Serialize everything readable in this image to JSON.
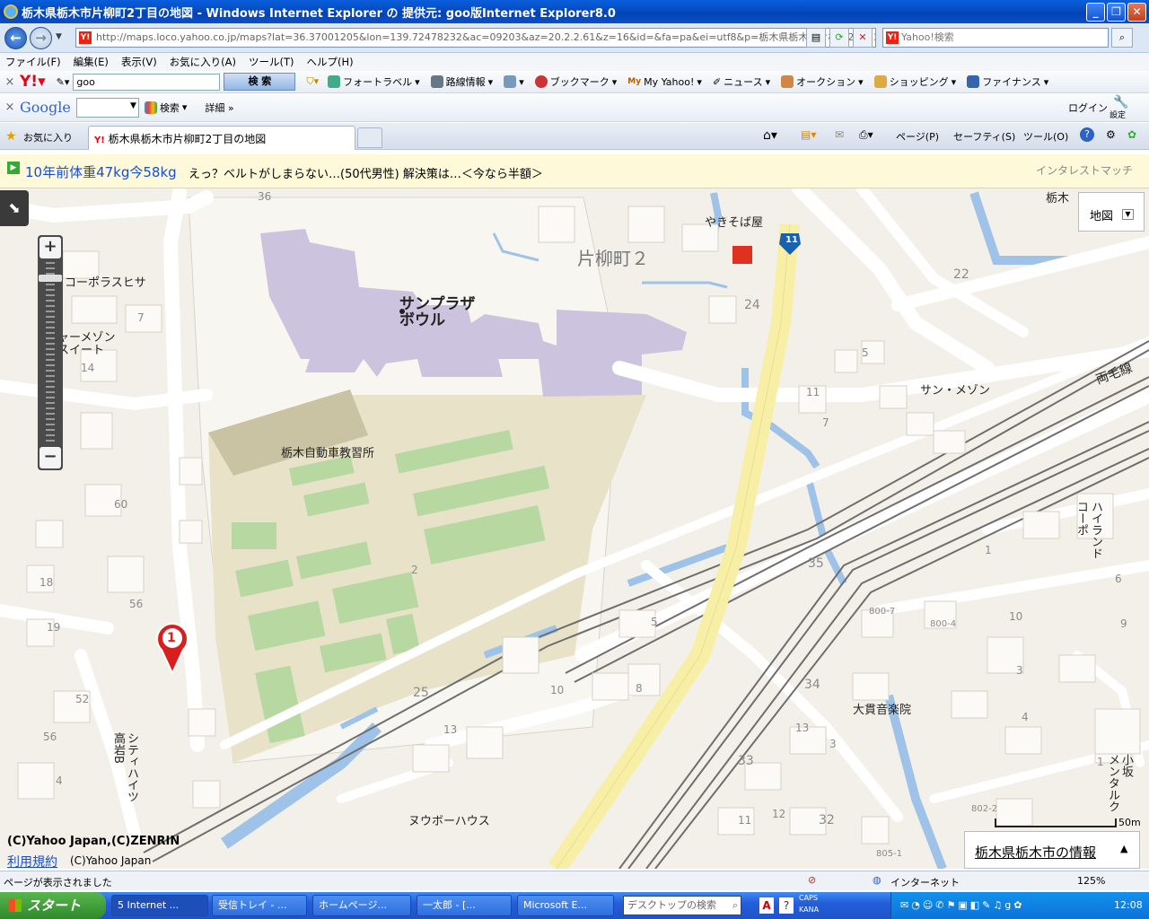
{
  "window": {
    "title": "栃木県栃木市片柳町2丁目の地図 - Windows Internet Explorer の 提供元: goo版Internet Explorer8.0"
  },
  "address_bar": {
    "url": "http://maps.loco.yahoo.co.jp/maps?lat=36.37001205&lon=139.72478232&ac=09203&az=20.2.2.61&z=16&id=&fa=pa&ei=utf8&p=栃木県栃木市片柳町2丁目2",
    "search_placeholder": "Yahoo!検索"
  },
  "menu": [
    "ファイル(F)",
    "編集(E)",
    "表示(V)",
    "お気に入り(A)",
    "ツール(T)",
    "ヘルプ(H)"
  ],
  "yahoo_toolbar": {
    "search_value": "goo",
    "search_button": "検 索",
    "items": [
      "フォートラベル",
      "路線情報",
      "ブックマーク",
      "My Yahoo!",
      "ニュース",
      "オークション",
      "ショッピング",
      "ファイナンス"
    ]
  },
  "google_toolbar": {
    "brand": "Google",
    "search_button": "検索",
    "details": "詳細 »",
    "login": "ログイン",
    "settings": "設定"
  },
  "favorites_bar": {
    "favorites": "お気に入り",
    "tab_title": "栃木県栃木市片柳町2丁目の地図",
    "commands": [
      "ページ(P)",
      "セーフティ(S)",
      "ツール(O)"
    ]
  },
  "ad": {
    "headline": "10年前体重47kg今58kg",
    "body": "えっ？ベルトがしまらない…(50代男性) 解決策は…＜今なら半額＞",
    "sponsor": "インタレストマッチ"
  },
  "map": {
    "type_button": "地図",
    "places": {
      "sunplaza": "サンプラザ\nボウル",
      "area": "片柳町２",
      "driving_school": "栃木自動車教習所",
      "yakisoba": "やきそば屋",
      "corpora": "コーポラスヒサ",
      "maison": "ャーメゾン\nスイート",
      "sun_maison": "サン・メゾン",
      "rail": "両毛線",
      "high_land": "ハイランド\nコーポ",
      "onkyo": "大貫音楽院",
      "nuvo": "ヌウボーハウス",
      "city_heights": "シティハイツ\n高岩B",
      "mental": "小坂\nメンタルク",
      "tochigi_partial": "栃木"
    },
    "road_number": "11",
    "marker_number": "1",
    "block_numbers": [
      "36",
      "7",
      "14",
      "60",
      "18",
      "56",
      "19",
      "52",
      "56",
      "4",
      "2",
      "5",
      "10",
      "8",
      "13",
      "25",
      "24",
      "22",
      "5",
      "11",
      "7",
      "35",
      "34",
      "33",
      "32",
      "12",
      "11",
      "13",
      "3",
      "10",
      "3",
      "9",
      "1",
      "4",
      "6",
      "800-7",
      "800-4",
      "802-2",
      "805-1",
      "1"
    ],
    "copyright": "(C)Yahoo Japan,(C)ZENRIN",
    "terms": "利用規約",
    "terms_copy": "(C)Yahoo Japan",
    "scale": "50m",
    "city_info": "栃木県栃木市の情報"
  },
  "status_bar": {
    "text": "ページが表示されました",
    "zone": "インターネット",
    "zoom": "125%"
  },
  "taskbar": {
    "start": "スタート",
    "tasks": [
      "5 Internet ...",
      "受信トレイ - ...",
      "ホームページ...",
      "一太郎 - [...",
      "Microsoft E..."
    ],
    "desktop_search": "デスクトップの検索",
    "caps": "CAPS",
    "kana": "KANA",
    "clock": "12:08"
  }
}
